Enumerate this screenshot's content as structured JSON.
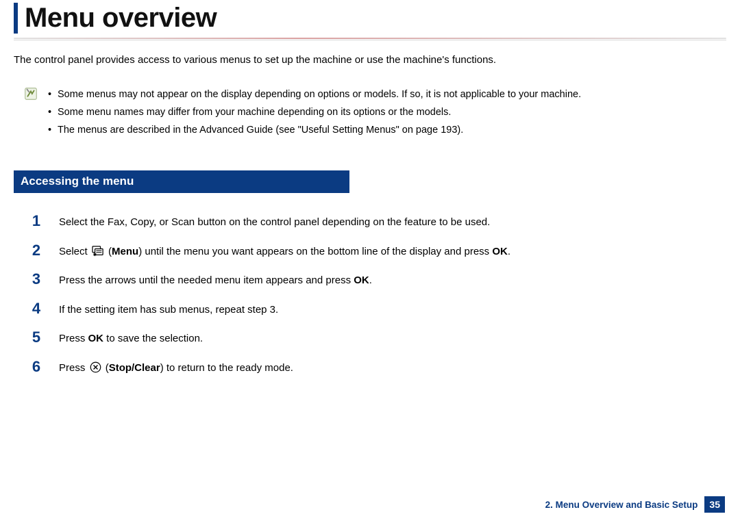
{
  "title": "Menu overview",
  "intro": "The control panel provides access to various menus to set up the machine or use the machine's functions.",
  "notes": [
    "Some menus may not appear on the display depending on options or models. If so, it is not applicable to your machine.",
    "Some menu names may differ from your machine depending on its options or the models.",
    "The menus are described in the Advanced Guide (see \"Useful Setting Menus\" on page 193)."
  ],
  "section_heading": "Accessing the menu",
  "steps": {
    "s1": "Select the Fax, Copy, or Scan button on the control panel depending on the feature to be used.",
    "s2_a": "Select ",
    "s2_b": " (",
    "s2_menu": "Menu",
    "s2_c": ") until the menu you want appears on the bottom line of the display and press ",
    "s2_ok": "OK",
    "s2_d": ".",
    "s3_a": "Press the arrows until the needed menu item appears and press ",
    "s3_ok": "OK",
    "s3_b": ".",
    "s4": "If the setting item has sub menus, repeat step 3.",
    "s5_a": "Press ",
    "s5_ok": "OK",
    "s5_b": " to save the selection.",
    "s6_a": "Press ",
    "s6_b": " (",
    "s6_stop": "Stop/Clear",
    "s6_c": ") to return to the ready mode."
  },
  "footer": {
    "chapter": "2. Menu Overview and Basic Setup",
    "page": "35"
  }
}
